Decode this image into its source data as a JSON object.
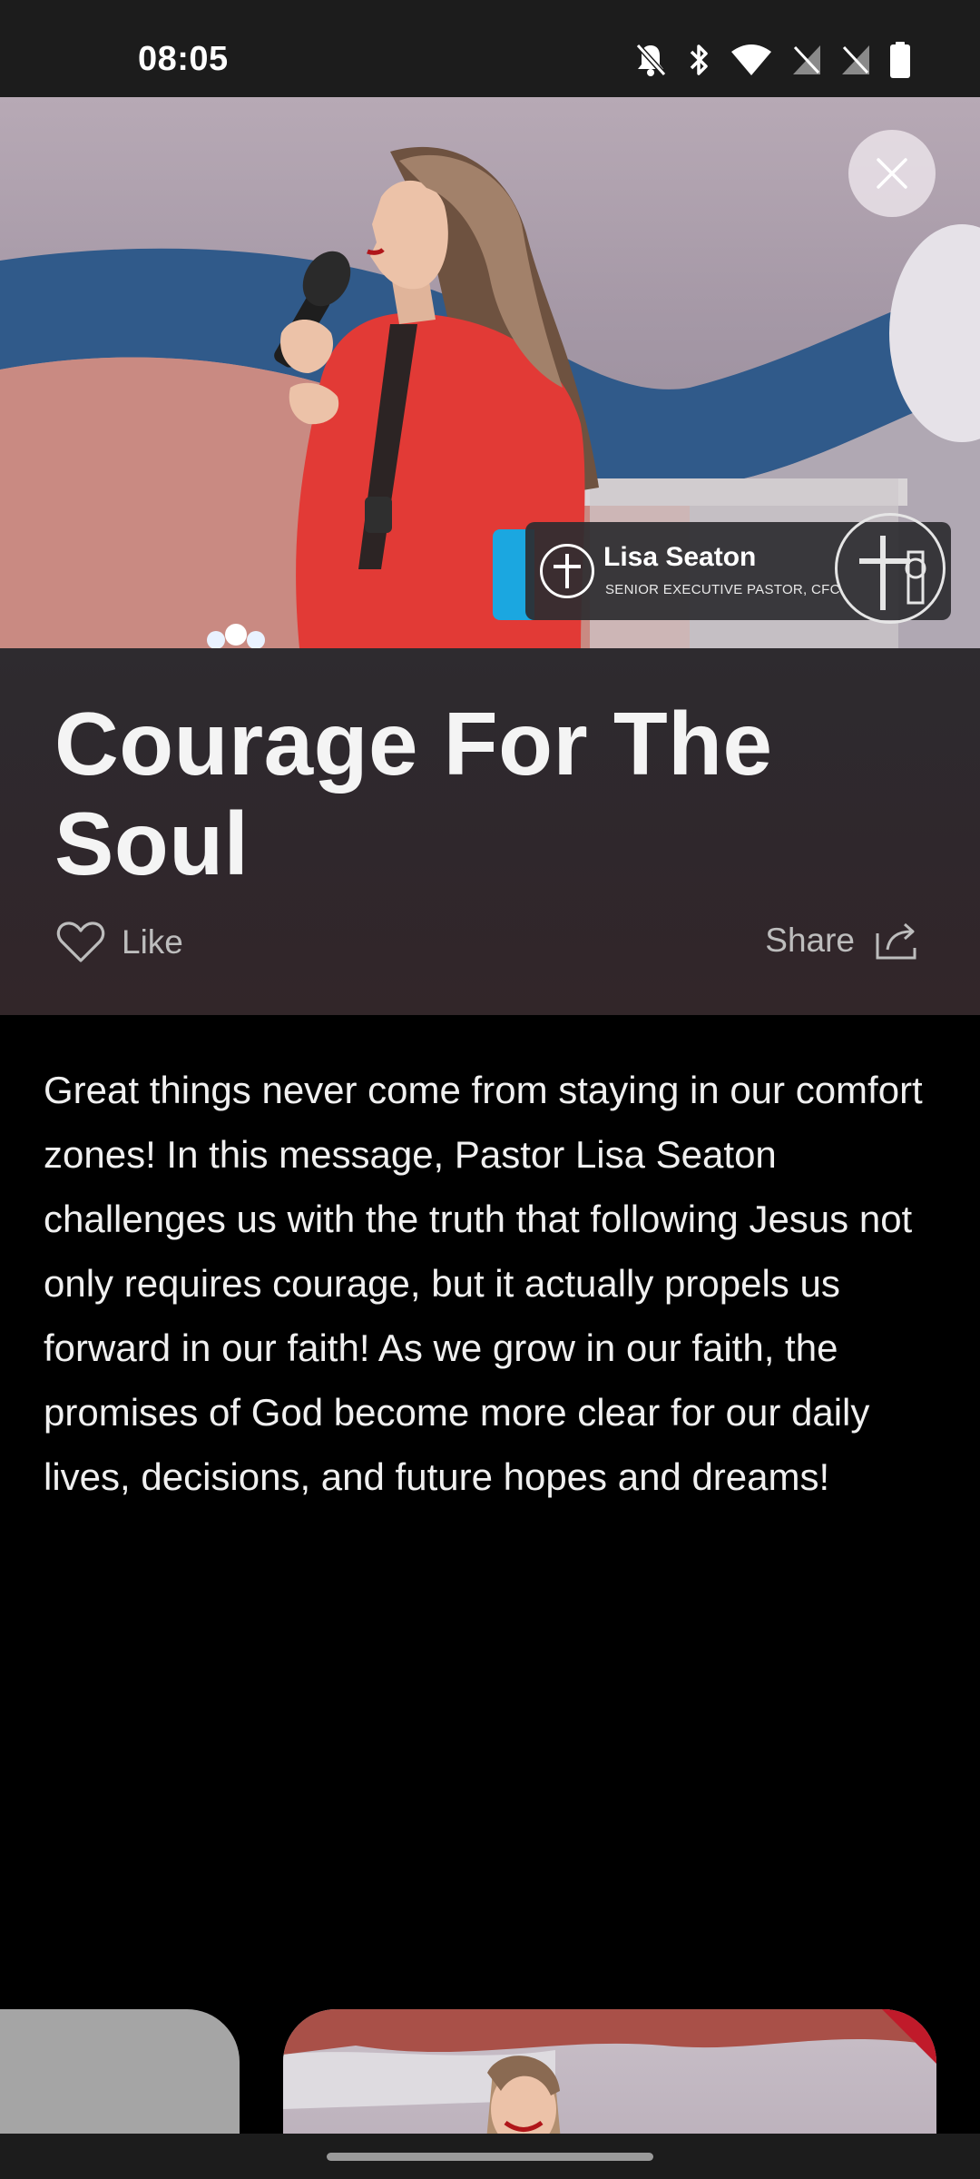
{
  "status_bar": {
    "time": "08:05",
    "icons": [
      "bell-off-icon",
      "bluetooth-icon",
      "wifi-icon",
      "no-sim-icon",
      "no-sim-icon",
      "battery-icon"
    ]
  },
  "hero": {
    "overlay": {
      "name": "Lisa Seaton",
      "title": "SENIOR EXECUTIVE PASTOR, CFC"
    },
    "close_icon": "close-icon"
  },
  "sermon": {
    "title": "Courage For The Soul",
    "like_label": "Like",
    "share_label": "Share",
    "description": "Great things never come from staying in our comfort zones! In this message, Pastor Lisa Seaton challenges us with the truth that following Jesus not only requires courage, but it actually propels us forward in our faith! As we grow in our faith, the promises of God become more clear for our daily lives, decisions, and future hopes and dreams!"
  },
  "colors": {
    "background": "#000000",
    "accent": "#1ba7e0",
    "title_panel": "#2e2b2f"
  }
}
